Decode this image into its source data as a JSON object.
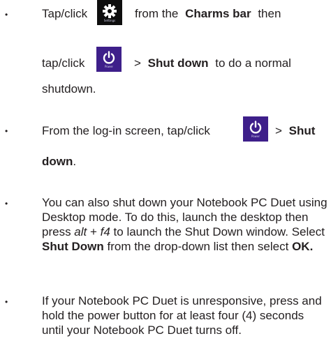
{
  "colors": {
    "text": "#231f20",
    "settings_tile": "#0e0e0e",
    "power_tile": "#3e1f8a"
  },
  "icons": {
    "settings": "gear-icon",
    "power": "power-icon"
  },
  "bullet_char": "•",
  "item1": {
    "tap_click": "Tap/click",
    "from_the": "from  the",
    "charms_bar": "Charms bar",
    "then": "then",
    "tap_click2": "tap/click",
    "gt": ">",
    "shut_down": "Shut down",
    "to_do_normal": "to do a normal",
    "shutdown": "shutdown."
  },
  "item2": {
    "from_login": "From the log-in screen, tap/click",
    "gt": ">",
    "shut": "Shut",
    "down": "down",
    "period": "."
  },
  "item3": {
    "t1": "You can also shut down your Notebook PC Duet using Desktop mode. To do this, launch the desktop then press ",
    "alt": "alt",
    "plus": " + ",
    "f4": "f4",
    "t2": " to launch the Shut Down window. Select ",
    "shut_down": "Shut Down",
    "t3": " from the drop-down list then select ",
    "ok": "OK."
  },
  "item4": {
    "text": "If your Notebook PC Duet is unresponsive, press and hold the power button for at least four (4) seconds until your Notebook PC Duet turns off."
  },
  "tiles": {
    "settings_caption": "Settings",
    "power_caption": "Power"
  }
}
